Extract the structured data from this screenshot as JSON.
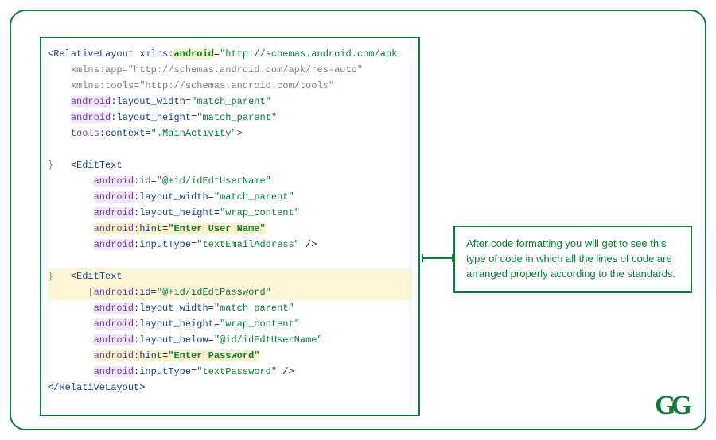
{
  "code": {
    "root_open": "RelativeLayout",
    "xmlns_android_ns": "xmlns:",
    "android_kw": "android",
    "xmlns_android_val": "http://schemas.android.com/apk",
    "xmlns_app": "xmlns:app=\"http://schemas.android.com/apk/res-auto\"",
    "xmlns_tools": "xmlns:tools=\"http://schemas.android.com/tools\"",
    "lw_attr": "layout_width",
    "lw_val": "match_parent",
    "lh_attr": "layout_height",
    "lh_val": "match_parent",
    "tools_ctx_attr": "tools",
    "tools_ctx_attr2": "context",
    "tools_ctx_val": ".MainActivity",
    "edit_text": "EditText",
    "id_attr": "id",
    "id1_val": "@+id/idEdtUserName",
    "lw_mp": "match_parent",
    "lh_wc": "wrap_content",
    "hint_attr": "hint",
    "hint1_val": "Enter User Name",
    "inputType_attr": "inputType",
    "it1_val": "textEmailAddress",
    "id2_val": "@+id/idEdtPassword",
    "lb_attr": "layout_below",
    "lb_val": "@id/idEdtUserName",
    "hint2_val": "Enter Password",
    "it2_val": "textPassword",
    "root_close": "/RelativeLayout"
  },
  "callout": {
    "text": "After code formatting you will get to see this type of code in which all the lines of code are arranged properly according to the standards."
  },
  "logo": "GG"
}
